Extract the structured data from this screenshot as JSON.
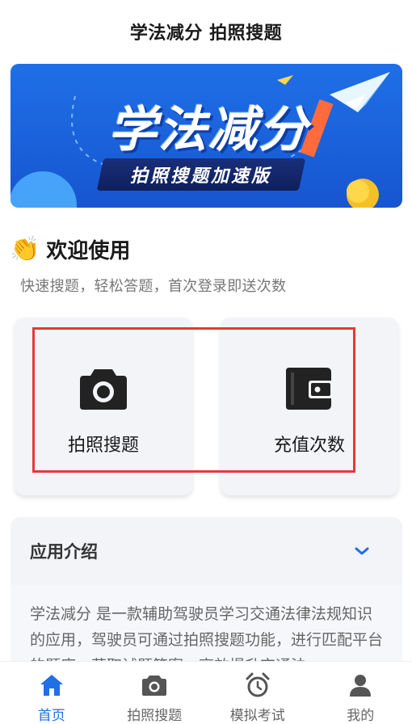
{
  "nav": {
    "title": "学法减分 拍照搜题"
  },
  "banner": {
    "title": "学法减分",
    "subtitle": "拍照搜题加速版"
  },
  "welcome": {
    "emoji": "👏",
    "title": "欢迎使用",
    "subtitle": "快速搜题，轻松答题，首次登录即送次数"
  },
  "actions": [
    {
      "label": "拍照搜题",
      "icon": "camera-icon"
    },
    {
      "label": "充值次数",
      "icon": "wallet-icon"
    }
  ],
  "intro": {
    "title": "应用介绍",
    "body": "学法减分 是一款辅助驾驶员学习交通法律法规知识的应用，驾驶员可通过拍照搜题功能，进行匹配平台的题库，获取试题答案，高效提升交通法"
  },
  "tabs": [
    {
      "label": "首页",
      "icon": "home-icon",
      "active": true
    },
    {
      "label": "拍照搜题",
      "icon": "camera-icon",
      "active": false
    },
    {
      "label": "模拟考试",
      "icon": "alarm-clock-icon",
      "active": false
    },
    {
      "label": "我的",
      "icon": "user-icon",
      "active": false
    }
  ],
  "colors": {
    "accent": "#1f6fe6",
    "highlight": "#e53935",
    "banner": "#1656d0"
  }
}
